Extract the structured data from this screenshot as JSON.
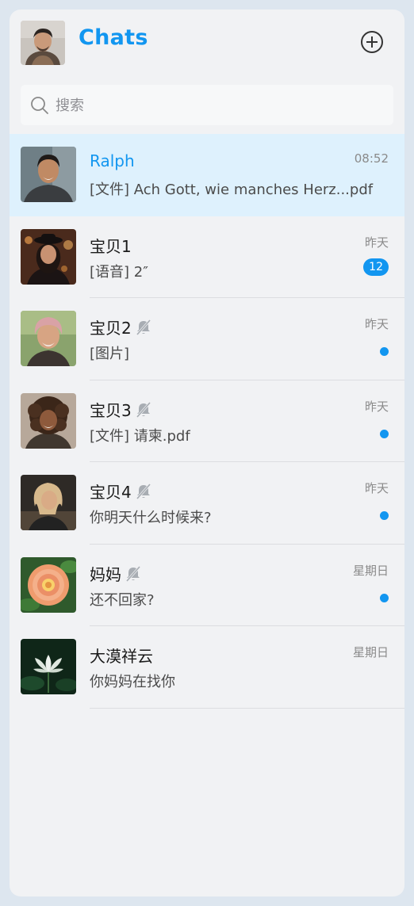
{
  "header": {
    "title": "Chats",
    "me_avatar": "user-avatar"
  },
  "search": {
    "placeholder": "搜索"
  },
  "chats": [
    {
      "name": "Ralph",
      "message": "[文件] Ach Gott, wie manches Herz...pdf",
      "time": "08:52",
      "muted": false,
      "unread": "",
      "active": true
    },
    {
      "name": "宝贝1",
      "message": "[语音] 2″",
      "time": "昨天",
      "muted": false,
      "unread": "12",
      "active": false
    },
    {
      "name": "宝贝2",
      "message": "[图片]",
      "time": "昨天",
      "muted": true,
      "unread": "dot",
      "active": false
    },
    {
      "name": "宝贝3",
      "message": "[文件] 请柬.pdf",
      "time": "昨天",
      "muted": true,
      "unread": "dot",
      "active": false
    },
    {
      "name": "宝贝4",
      "message": "你明天什么时候来?",
      "time": "昨天",
      "muted": true,
      "unread": "dot",
      "active": false
    },
    {
      "name": "妈妈",
      "message": "还不回家?",
      "time": "星期日",
      "muted": true,
      "unread": "dot",
      "active": false
    },
    {
      "name": "大漠祥云",
      "message": "你妈妈在找你",
      "time": "星期日",
      "muted": false,
      "unread": "",
      "active": false
    }
  ],
  "colors": {
    "accent": "#1296f0",
    "active_row": "#def1fd",
    "background": "#f1f2f4"
  }
}
